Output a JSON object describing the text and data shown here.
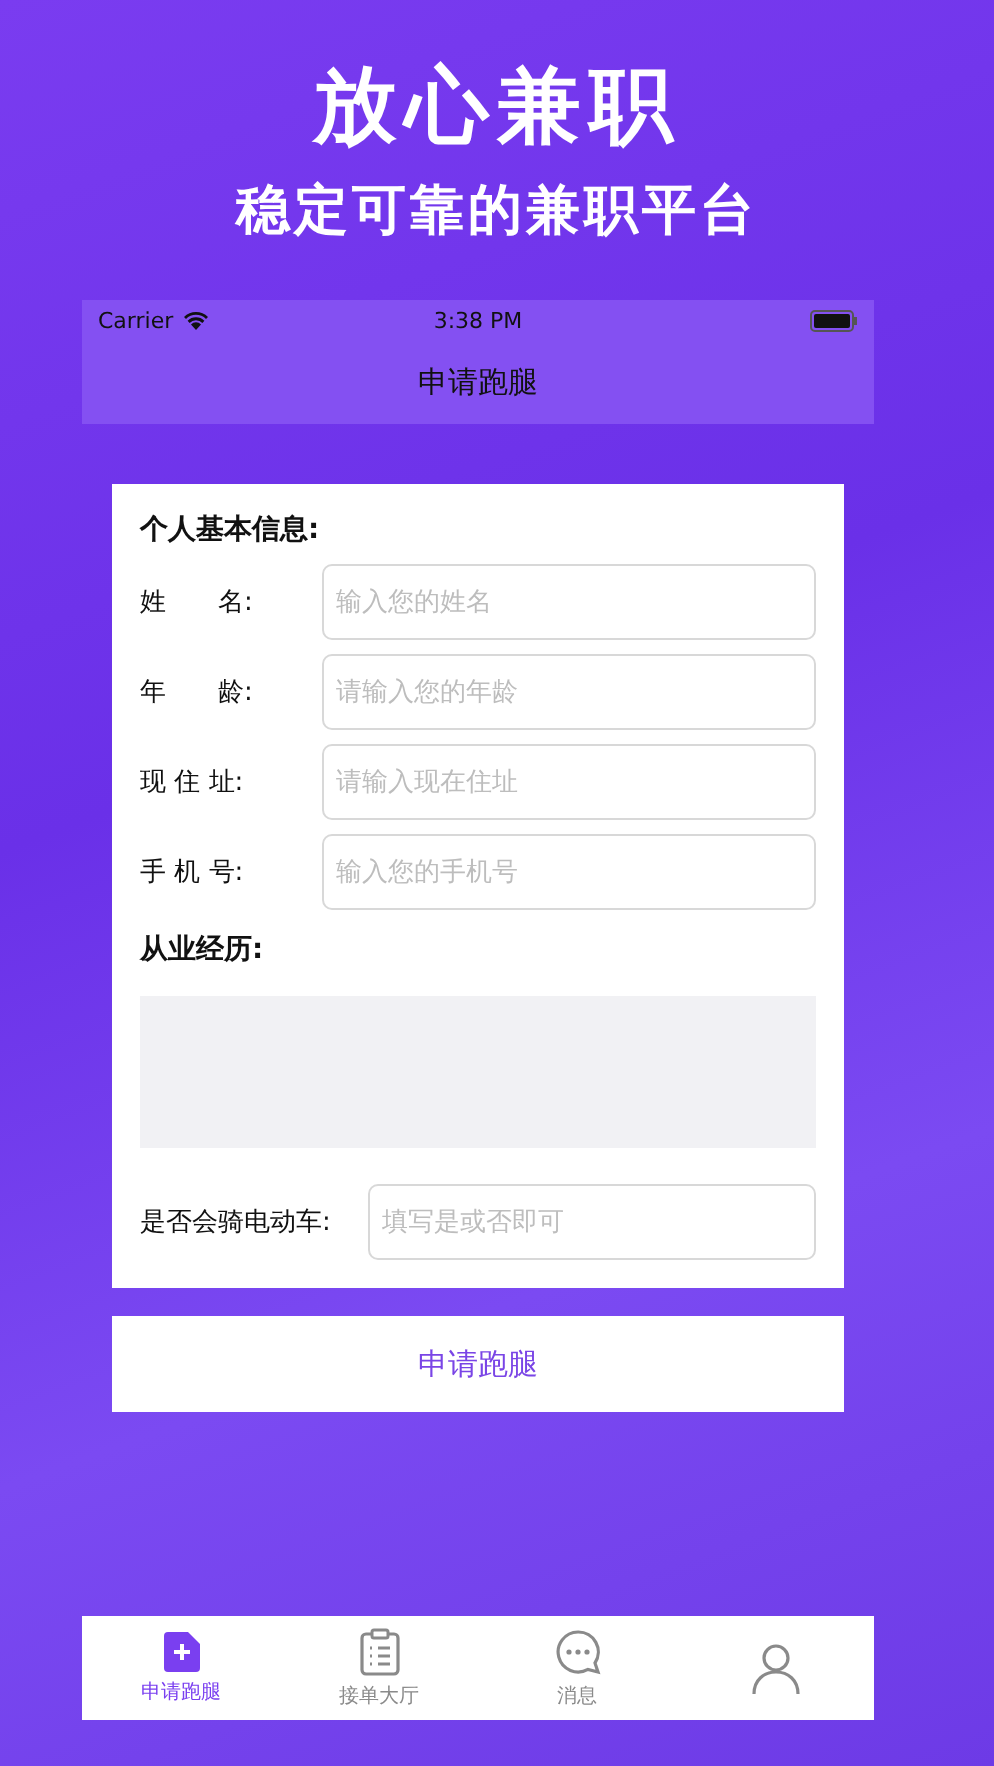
{
  "promo": {
    "title": "放心兼职",
    "subtitle": "稳定可靠的兼职平台"
  },
  "status_bar": {
    "carrier": "Carrier",
    "time": "3:38 PM"
  },
  "nav": {
    "title": "申请跑腿"
  },
  "form": {
    "section_title": "个人基本信息:",
    "fields": [
      {
        "label": "姓　　名:",
        "placeholder": "输入您的姓名"
      },
      {
        "label": "年　　龄:",
        "placeholder": "请输入您的年龄"
      },
      {
        "label": "现 住 址:",
        "placeholder": "请输入现在住址"
      },
      {
        "label": "手 机 号:",
        "placeholder": "输入您的手机号"
      }
    ],
    "experience_label": "从业经历:",
    "riding": {
      "label": "是否会骑电动车:",
      "placeholder": "填写是或否即可"
    }
  },
  "submit_button": "申请跑腿",
  "tabs": [
    {
      "label": "申请跑腿",
      "selected": true
    },
    {
      "label": "接单大厅",
      "selected": false
    },
    {
      "label": "消息",
      "selected": false
    },
    {
      "selected": false
    }
  ]
}
